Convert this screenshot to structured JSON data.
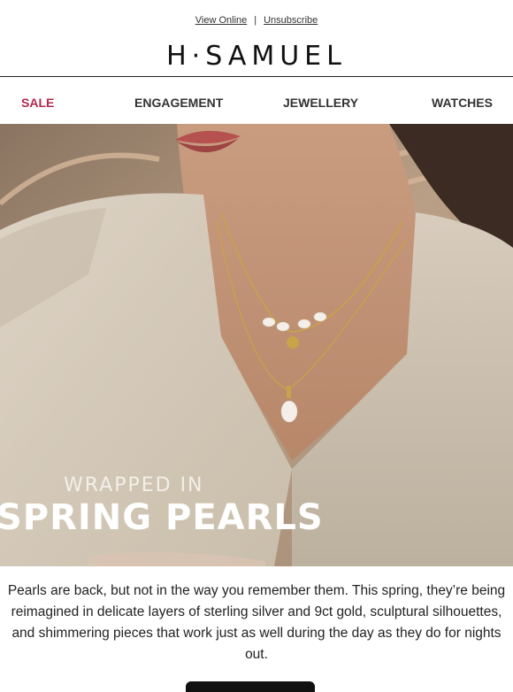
{
  "header": {
    "view_online": "View Online",
    "separator": "|",
    "unsubscribe": "Unsubscribe",
    "logo": "H·SAMUEL"
  },
  "nav": {
    "items": [
      {
        "label": "SALE",
        "color": "#b02a4e"
      },
      {
        "label": "ENGAGEMENT"
      },
      {
        "label": "JEWELLERY"
      },
      {
        "label": "WATCHES"
      }
    ]
  },
  "hero": {
    "line1": "WRAPPED IN",
    "line2": "SPRING PEARLS"
  },
  "body": {
    "copy": "Pearls are back, but not in the way you remember them. This spring, they’re being reimagined in delicate layers of sterling silver and 9ct gold, sculptural silhouettes, and shimmering pieces that work just as well during the day as they do for nights out."
  },
  "colors": {
    "accent": "#b02a4e",
    "cta": "#111111"
  }
}
